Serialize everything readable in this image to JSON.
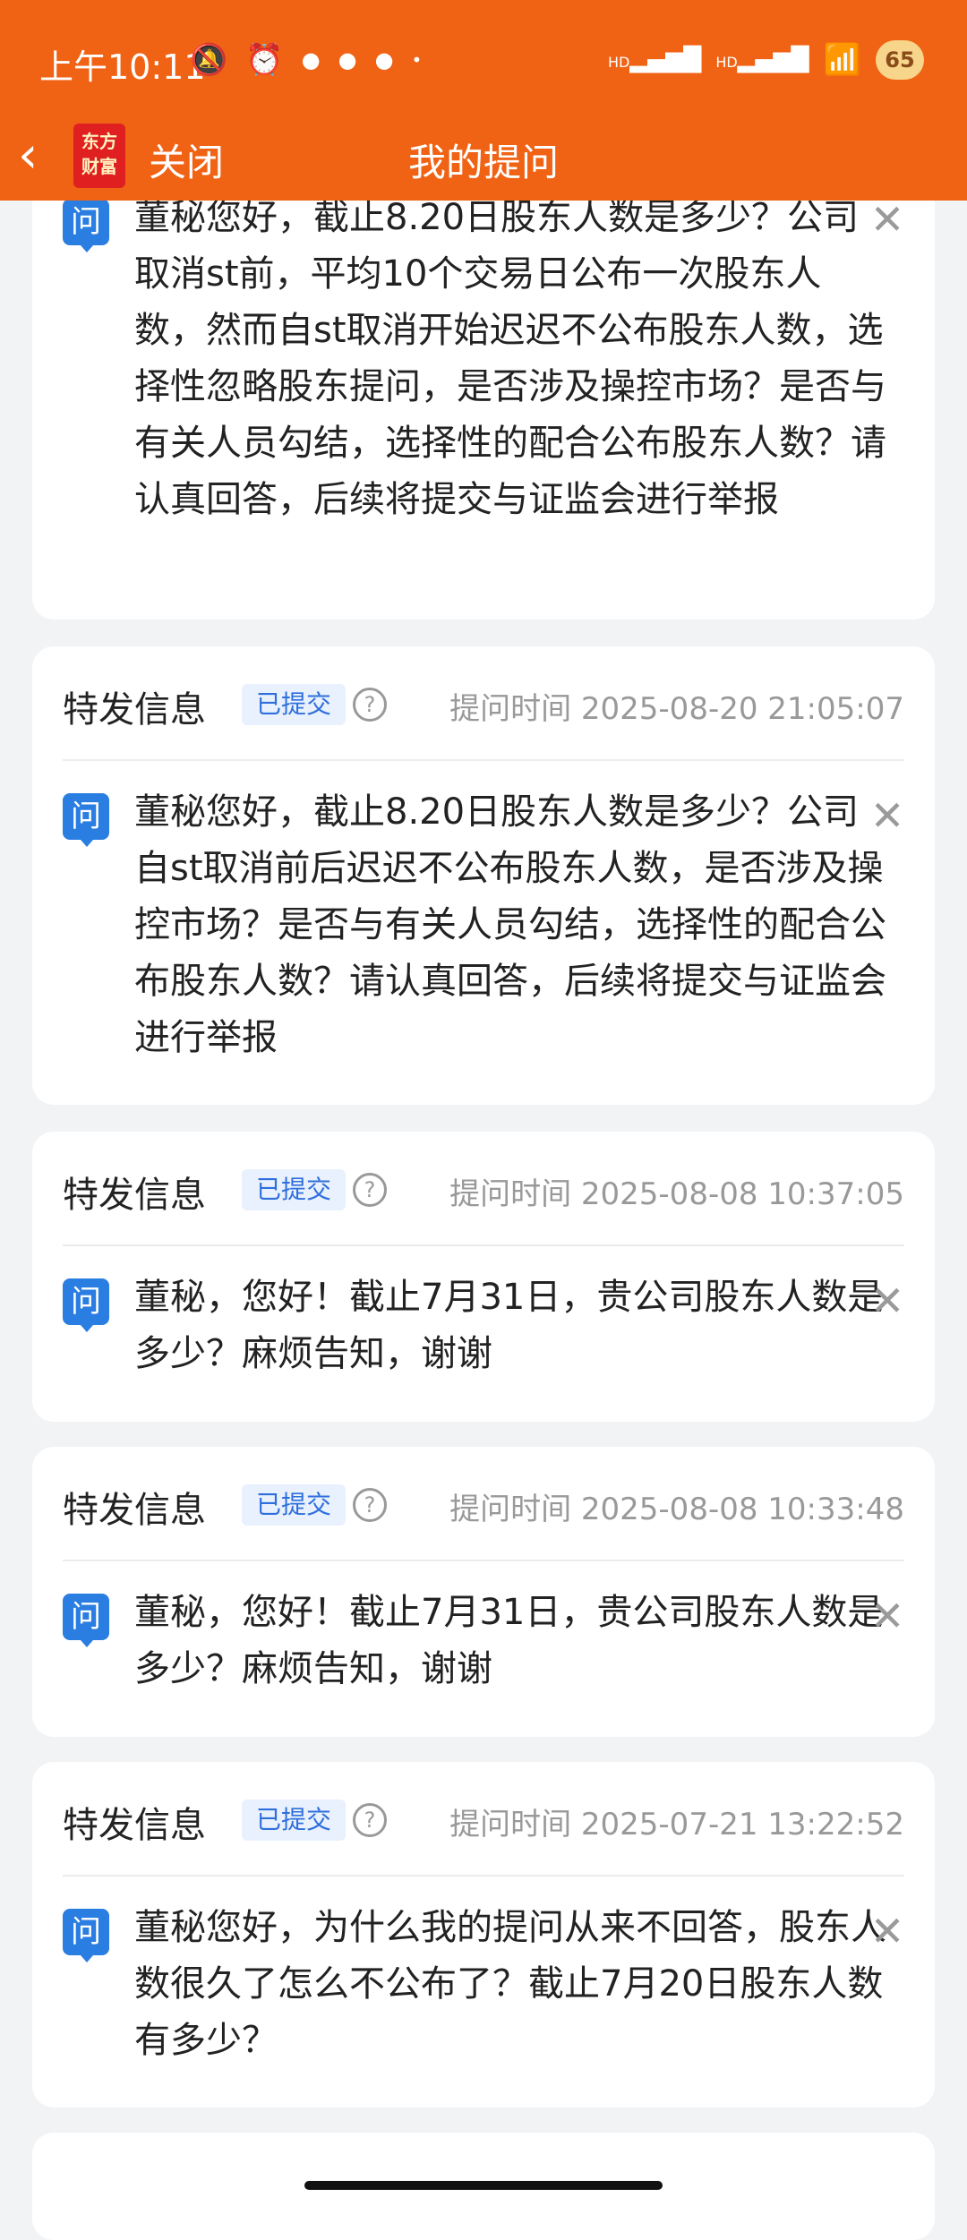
{
  "status_bar": {
    "time": "上午10:11",
    "battery": "65",
    "signal1": "HD",
    "signal2": "HD"
  },
  "nav": {
    "close": "关闭",
    "title": "我的提问",
    "logo_line1": "东方",
    "logo_line2": "财富"
  },
  "partial_question": {
    "text": "董秘您好，截止8.20日股东人数是多少？公司取消st前，平均10个交易日公布一次股东人数，然而自st取消开始迟迟不公布股东人数，选择性忽略股东提问，是否涉及操控市场？是否与有关人员勾结，选择性的配合公布股东人数？请认真回答，后续将提交与证监会进行举报"
  },
  "questions": [
    {
      "tag": "特发信息",
      "status": "已提交",
      "time": "提问时间 2025-08-20 21:05:07",
      "text": "董秘您好，截止8.20日股东人数是多少？公司自st取消前后迟迟不公布股东人数，是否涉及操控市场？是否与有关人员勾结，选择性的配合公布股东人数？请认真回答，后续将提交与证监会进行举报"
    },
    {
      "tag": "特发信息",
      "status": "已提交",
      "time": "提问时间 2025-08-08 10:37:05",
      "text": "董秘，您好！截止7月31日，贵公司股东人数是多少？麻烦告知，谢谢"
    },
    {
      "tag": "特发信息",
      "status": "已提交",
      "time": "提问时间 2025-08-08 10:33:48",
      "text": "董秘，您好！截止7月31日，贵公司股东人数是多少？麻烦告知，谢谢"
    },
    {
      "tag": "特发信息",
      "status": "已提交",
      "time": "提问时间 2025-07-21 13:22:52",
      "text": "董秘您好，为什么我的提问从来不回答，股东人数很久了怎么不公布了？截止7月20日股东人数有多少？"
    }
  ],
  "q_label": "问",
  "help_label": "?",
  "close_glyph": "✕"
}
